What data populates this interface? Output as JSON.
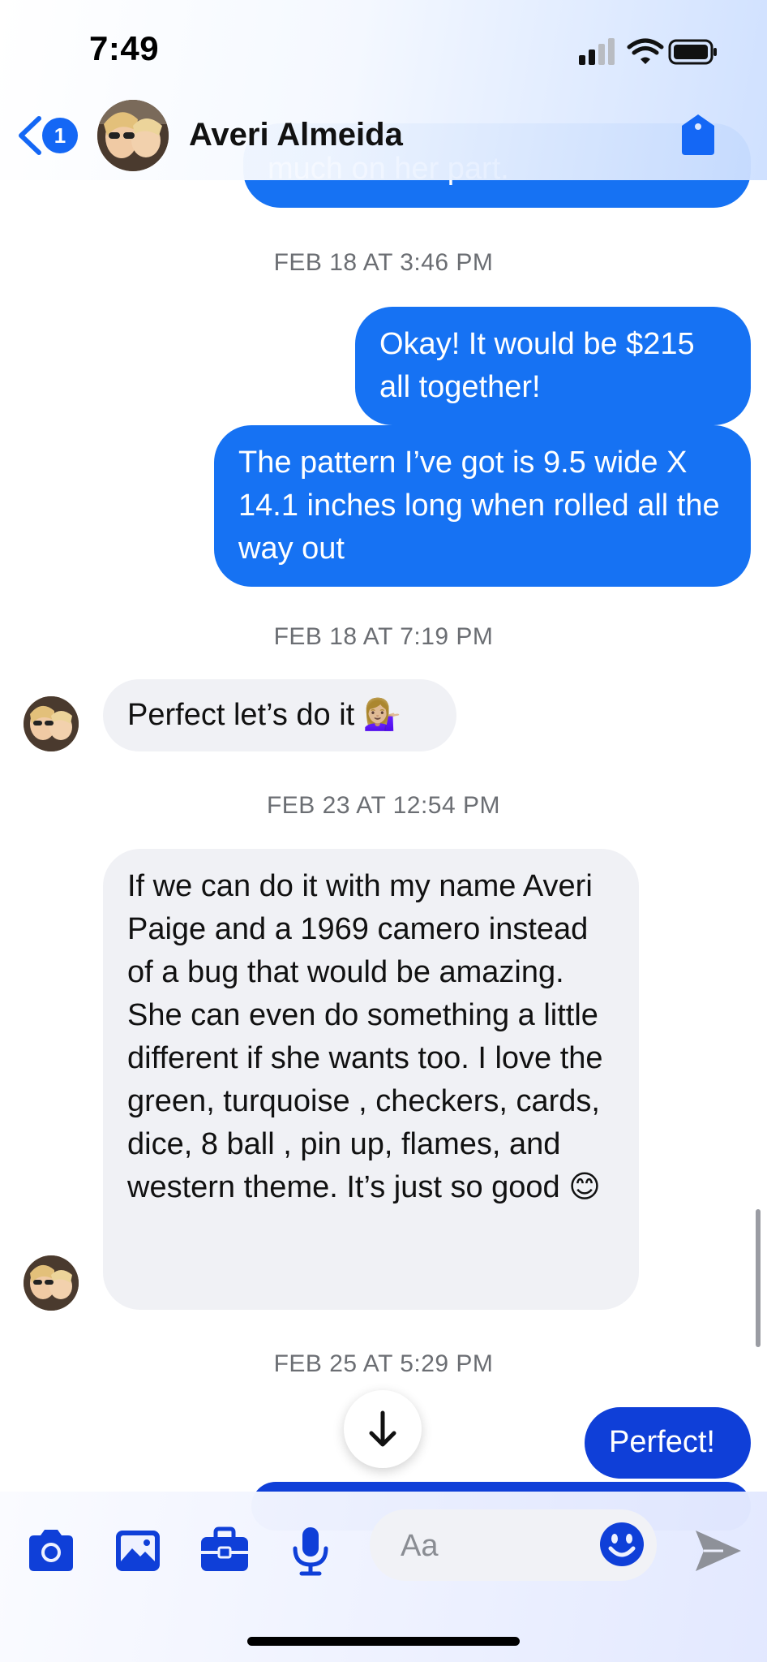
{
  "status_bar": {
    "time": "7:49"
  },
  "header": {
    "back_badge": "1",
    "contact_name": "Averi Almeida"
  },
  "thread": {
    "top_partial_text": "much on her part.",
    "ts1": "FEB 18 AT 3:46 PM",
    "out1": "Okay! It would be $215 all together!",
    "out2": "The pattern I’ve got is 9.5 wide X 14.1 inches long when rolled all the way out",
    "ts2": "FEB 18 AT 7:19 PM",
    "in1": "Perfect let’s do it 💁🏼‍♀️",
    "ts3": "FEB 23 AT 12:54 PM",
    "in2": "If we can do it with my name Averi Paige and a 1969 camero instead of a bug that would be amazing. She can even do something a little different if she wants too. I love the green, turquoise , checkers, cards, dice, 8 ball , pin up, flames, and western theme. It’s just so good 😊",
    "ts4": "FEB 25 AT 5:29 PM",
    "out3": "Perfect!"
  },
  "composer": {
    "placeholder": "Aa"
  },
  "colors": {
    "accent": "#1467f5",
    "outgoing_bubble": "#1672f3",
    "outgoing_bubble_recent": "#0f3fd8",
    "incoming_bubble": "#f0f1f5",
    "timestamp": "#6b6e73"
  },
  "icons": {
    "status": [
      "signal-icon",
      "wifi-icon",
      "battery-icon"
    ],
    "header": [
      "back-chevron-icon",
      "tag-icon"
    ],
    "toolbar": [
      "camera-icon",
      "photo-icon",
      "briefcase-icon",
      "microphone-icon",
      "emoji-icon",
      "send-icon"
    ],
    "other": [
      "arrow-down-icon"
    ]
  }
}
